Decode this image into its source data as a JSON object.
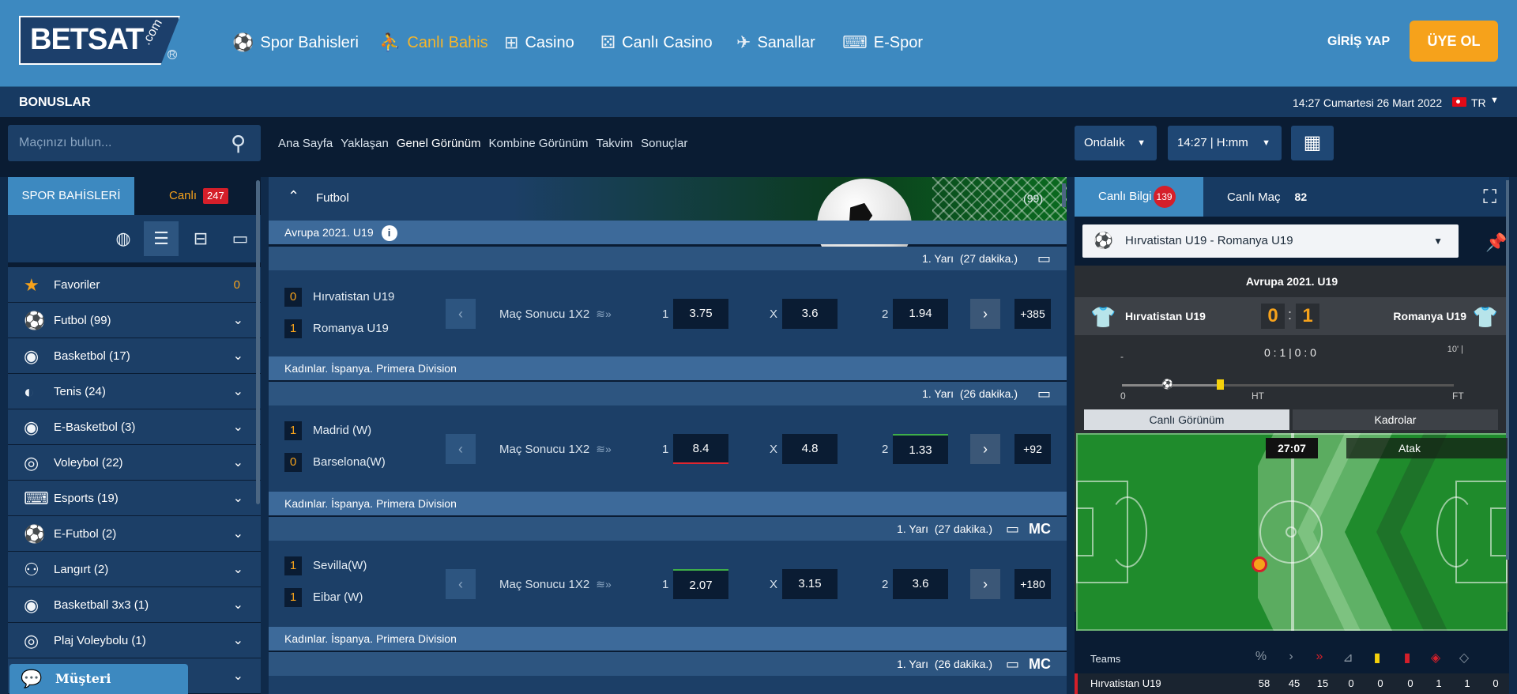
{
  "header": {
    "logo_text": "BETSAT",
    "logo_suffix": ".com",
    "reg_mark": "R",
    "nav": [
      {
        "label": "Spor Bahisleri",
        "icon": "soccer-ball-icon"
      },
      {
        "label": "Canlı Bahis",
        "icon": "live-player-icon",
        "active": true
      },
      {
        "label": "Casino",
        "icon": "slot-machine-icon"
      },
      {
        "label": "Canlı Casino",
        "icon": "dice-icon"
      },
      {
        "label": "Sanallar",
        "icon": "virtual-icon"
      },
      {
        "label": "E-Spor",
        "icon": "gamepad-icon"
      }
    ],
    "login_label": "GİRİŞ YAP",
    "register_label": "ÜYE OL"
  },
  "bonus_bar": {
    "bonus_label": "BONUSLAR",
    "datetime": "14:27 Cumartesi 26 Mart 2022",
    "language": "TR"
  },
  "toolbar": {
    "search_placeholder": "Maçınızı bulun...",
    "tabs": [
      "Ana Sayfa",
      "Yaklaşan",
      "Genel Görünüm",
      "Kombine Görünüm",
      "Takvim",
      "Sonuçlar"
    ],
    "odds_format": "Ondalık",
    "time_format": "14:27 | H:mm"
  },
  "sidebar": {
    "tab_sports": "SPOR BAHİSLERİ",
    "tab_live": "Canlı",
    "live_count": "247",
    "favorites_label": "Favoriler",
    "favorites_count": "0",
    "sports": [
      {
        "label": "Futbol (99)",
        "icon": "soccer-ball-icon"
      },
      {
        "label": "Basketbol (17)",
        "icon": "basketball-icon"
      },
      {
        "label": "Tenis (24)",
        "icon": "tennis-ball-icon"
      },
      {
        "label": "E-Basketbol (3)",
        "icon": "e-basketball-icon"
      },
      {
        "label": "Voleybol (22)",
        "icon": "volleyball-icon"
      },
      {
        "label": "Esports (19)",
        "icon": "gamepad-icon"
      },
      {
        "label": "E-Futbol (2)",
        "icon": "e-soccer-icon"
      },
      {
        "label": "Langırt (2)",
        "icon": "foosball-icon"
      },
      {
        "label": "Basketball 3x3 (1)",
        "icon": "basketball-3x3-icon"
      },
      {
        "label": "Plaj Voleybolu (1)",
        "icon": "beach-volleyball-icon"
      }
    ],
    "chat_label": "Müşteri Hizmetleri"
  },
  "center": {
    "sport_title": "Futbol",
    "sport_count": "(99)",
    "match_type": "Maç Sonucu 1X2",
    "more_labels": {
      "home": "1",
      "draw": "X",
      "away": "2"
    },
    "leagues": [
      {
        "name": "Avrupa 2021. U19",
        "period": "1. Yarı",
        "minute": "(27 dakika.)",
        "home": "Hırvatistan U19",
        "home_score": "0",
        "away": "Romanya U19",
        "away_score": "1",
        "odd_1": "3.75",
        "odd_x": "3.6",
        "odd_2": "1.94",
        "more": "+385"
      },
      {
        "name": "Kadınlar. İspanya. Primera Division",
        "period": "1. Yarı",
        "minute": "(26 dakika.)",
        "home": "Madrid (W)",
        "home_score": "1",
        "away": "Barselona(W)",
        "away_score": "0",
        "odd_1": "8.4",
        "odd_x": "4.8",
        "odd_2": "1.33",
        "more": "+92"
      },
      {
        "name": "Kadınlar. İspanya. Primera Division",
        "period": "1. Yarı",
        "minute": "(27 dakika.)",
        "home": "Sevilla(W)",
        "home_score": "1",
        "away": "Eibar (W)",
        "away_score": "1",
        "odd_1": "2.07",
        "odd_x": "3.15",
        "odd_2": "3.6",
        "more": "+180"
      },
      {
        "name": "Kadınlar. İspanya. Primera Division",
        "period": "1. Yarı",
        "minute": "(26 dakika.)"
      }
    ],
    "mc_label": "MC"
  },
  "right": {
    "tab_live_info": "Canlı Bilgi",
    "live_info_count": "139",
    "tab_live_match": "Canlı Maç",
    "live_match_count": "82",
    "selected_match": "Hırvatistan U19 - Romanya U19",
    "scoreboard": {
      "league": "Avrupa 2021. U19",
      "home": "Hırvatistan U19",
      "away": "Romanya U19",
      "home_score": "0",
      "away_score": "1",
      "colon": ":",
      "dash": "-",
      "score_line": "0 : 1 | 0 : 0",
      "minute_label": "10' |",
      "tl_start": "0",
      "tl_ht": "HT",
      "tl_ft": "FT",
      "progress": 0.3
    },
    "sub_tabs": [
      "Canlı Görünüm",
      "Kadrolar"
    ],
    "clock": "27:07",
    "attack_label": "Atak",
    "stats": {
      "header": "Teams",
      "icons": [
        "possession-icon",
        "attack-icon",
        "dangerous-attack-icon",
        "corner-icon",
        "yellow-card-icon",
        "red-card-icon",
        "shot-on-target-icon",
        "shot-off-target-icon"
      ],
      "home_name": "Hırvatistan U19",
      "home_values": [
        "58",
        "45",
        "15",
        "0",
        "0",
        "0",
        "1",
        "1",
        "0"
      ]
    }
  }
}
